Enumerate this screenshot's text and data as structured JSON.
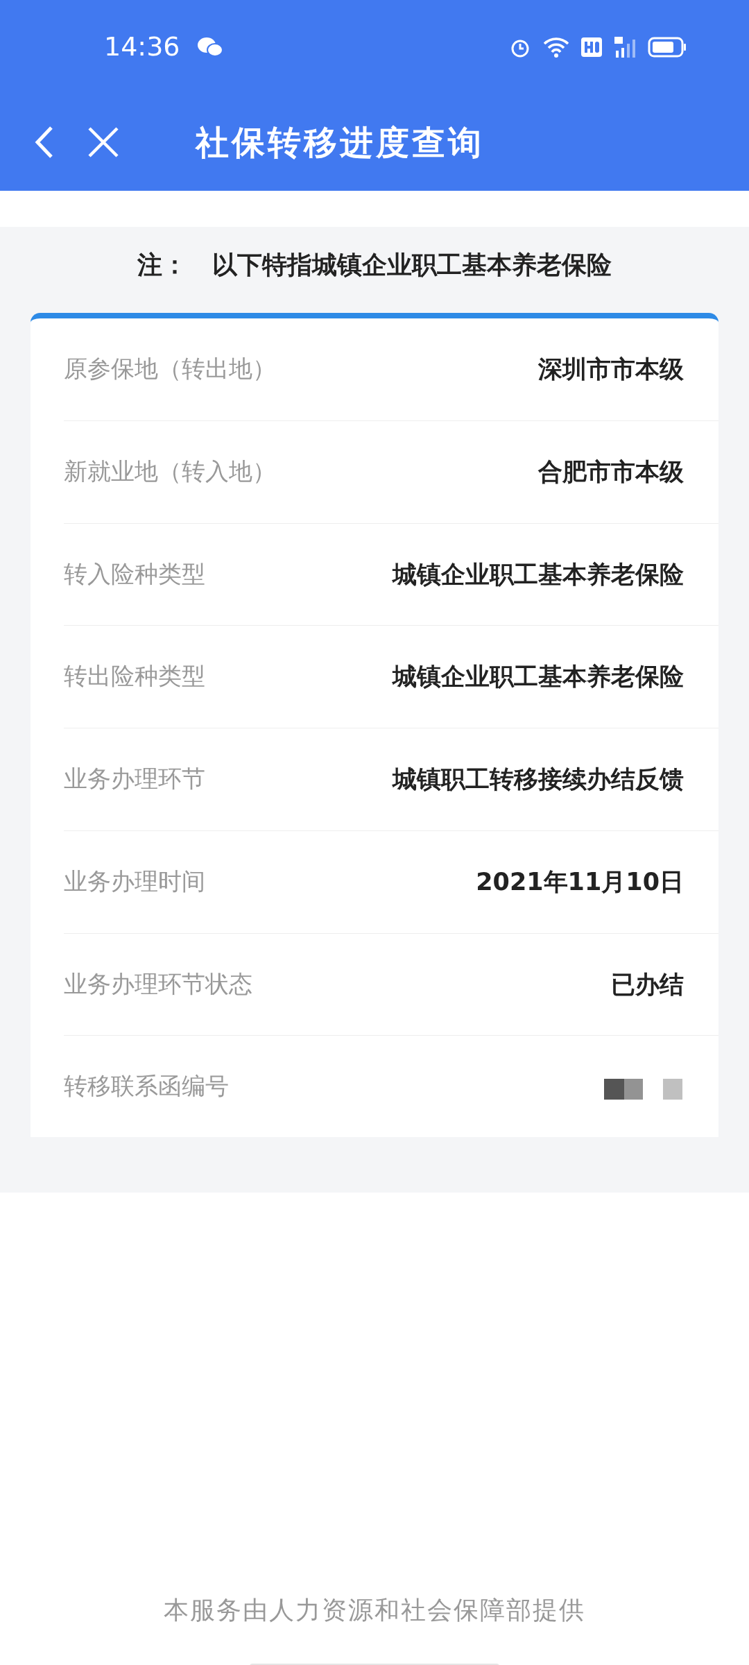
{
  "status_bar": {
    "time": "14:36"
  },
  "header": {
    "title": "社保转移进度查询"
  },
  "note": "注：　以下特指城镇企业职工基本养老保险",
  "rows": [
    {
      "label": "原参保地（转出地）",
      "value": "深圳市市本级"
    },
    {
      "label": "新就业地（转入地）",
      "value": "合肥市市本级"
    },
    {
      "label": "转入险种类型",
      "value": "城镇企业职工基本养老保险"
    },
    {
      "label": "转出险种类型",
      "value": "城镇企业职工基本养老保险"
    },
    {
      "label": "业务办理环节",
      "value": "城镇职工转移接续办结反馈"
    },
    {
      "label": "业务办理时间",
      "value": "2021年11月10日"
    },
    {
      "label": "业务办理环节状态",
      "value": "已办结"
    },
    {
      "label": "转移联系函编号",
      "redacted": true
    }
  ],
  "footer": "本服务由人力资源和社会保障部提供"
}
